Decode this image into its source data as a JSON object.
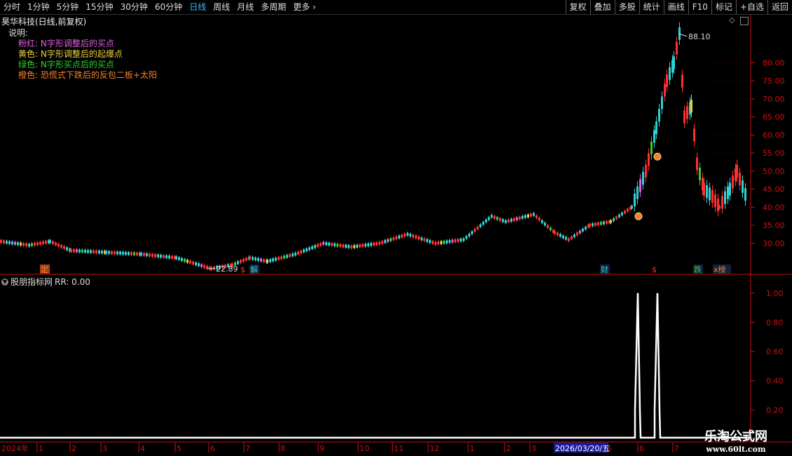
{
  "toolbar": {
    "left_items": [
      "分时",
      "1分钟",
      "5分钟",
      "15分钟",
      "30分钟",
      "60分钟",
      "日线",
      "周线",
      "月线",
      "多周期",
      "更多"
    ],
    "active": "日线",
    "right_items": [
      "复权",
      "叠加",
      "多股",
      "统计",
      "画线",
      "F10",
      "标记",
      "+自选",
      "返回"
    ]
  },
  "main_panel": {
    "title": "昊华科技(日线,前复权)",
    "legend_label": "说明:",
    "legend": [
      {
        "text": "粉红: N字形调整后的买点",
        "color": "#e060e0"
      },
      {
        "text": "黄色: N字形调整后的起爆点",
        "color": "#e8d040"
      },
      {
        "text": "绿色: N字形买点后的买点",
        "color": "#30d030"
      },
      {
        "text": "橙色: 恐慌式下跌后的反包二板+太阳",
        "color": "#f08030"
      }
    ],
    "price_axis": [
      "80.00",
      "75.00",
      "70.00",
      "65.00",
      "60.00",
      "55.00",
      "50.00",
      "45.00",
      "40.00",
      "35.00",
      "30.00"
    ],
    "high_label": "88.10",
    "low_label": "22.89",
    "markers": [
      "定",
      "$",
      "解",
      "财",
      "$",
      "跌",
      "x榜"
    ]
  },
  "sub_panel": {
    "title": "股朋指标网",
    "rr_label": "RR: 0.00",
    "axis": [
      "1.00",
      "0.80",
      "0.60",
      "0.40",
      "0.20"
    ]
  },
  "date_axis": {
    "year": "2024年",
    "months": [
      "1",
      "2",
      "3",
      "4",
      "5",
      "6",
      "7",
      "8",
      "9",
      "10",
      "11",
      "12",
      "1",
      "2",
      "3",
      "5",
      "6",
      "7"
    ],
    "cursor_date": "2026/03/20/五"
  },
  "watermark": {
    "line1": "乐淘公式网",
    "line2": "www.60lt.com"
  },
  "chart_data": {
    "type": "candlestick",
    "ylim": [
      22,
      90
    ],
    "high": 88.1,
    "low": 22.89,
    "indicator_ylim": [
      0,
      1.1
    ],
    "indicator_spikes": [
      1.0,
      1.0
    ]
  }
}
